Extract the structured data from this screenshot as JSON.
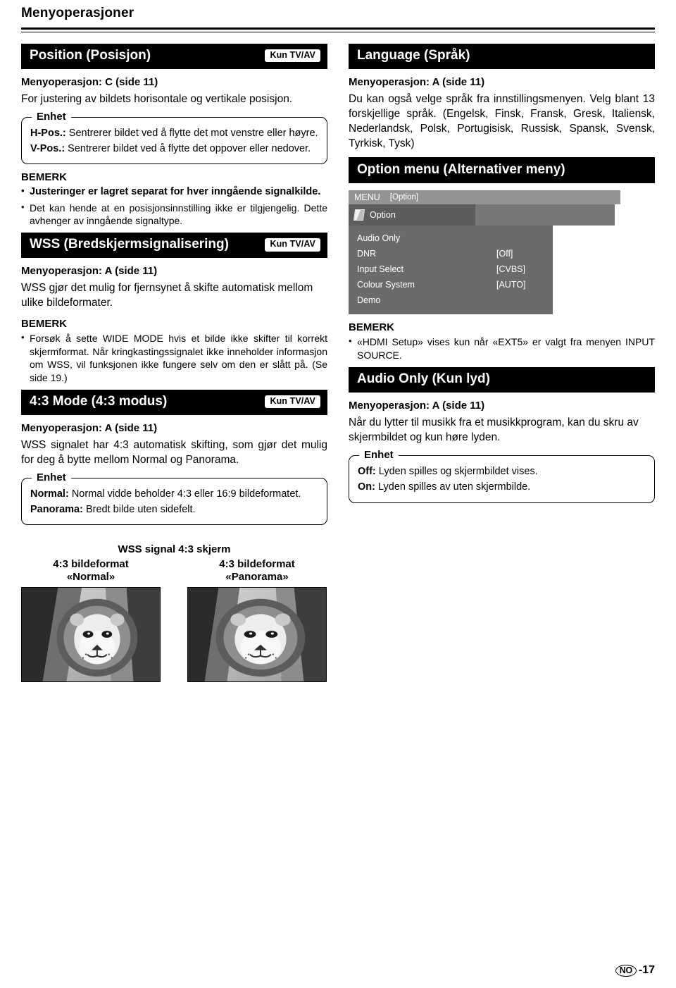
{
  "header": {
    "title": "Menyoperasjoner"
  },
  "left": {
    "position": {
      "title": "Position (Posisjon)",
      "badge": "Kun TV/AV",
      "menuop": "Menyoperasjon: C (side 11)",
      "intro": "For justering av bildets horisontale og vertikale posisjon.",
      "enhet_legend": "Enhet",
      "hpos_label": "H-Pos.:",
      "hpos_text": " Sentrerer bildet ved å flytte det mot venstre eller høyre.",
      "vpos_label": "V-Pos.:",
      "vpos_text": " Sentrerer bildet ved å flytte det oppover eller nedover.",
      "bemerk": "BEMERK",
      "notes": [
        "Justeringer er lagret separat for hver inngående signalkilde.",
        "Det kan hende at en posisjonsinnstilling ikke er tilgjengelig. Dette avhenger av inngående signaltype."
      ]
    },
    "wss": {
      "title": "WSS (Bredskjermsignalisering)",
      "badge": "Kun TV/AV",
      "menuop": "Menyoperasjon: A (side 11)",
      "intro": "WSS gjør det mulig for fjernsynet å skifte automatisk mellom ulike bildeformater.",
      "bemerk": "BEMERK",
      "notes": [
        "Forsøk å sette WIDE MODE hvis et bilde ikke skifter til korrekt skjermformat. Når kringkastingssignalet ikke inneholder informasjon om WSS, vil funksjonen ikke fungere selv om den er slått på. (Se side 19.)"
      ]
    },
    "mode43": {
      "title": "4:3 Mode (4:3 modus)",
      "badge": "Kun TV/AV",
      "menuop": "Menyoperasjon: A (side 11)",
      "intro": "WSS signalet har 4:3 automatisk skifting, som gjør det mulig for deg å bytte mellom Normal og Panorama.",
      "enhet_legend": "Enhet",
      "normal_label": "Normal:",
      "normal_text": " Normal vidde beholder 4:3 eller 16:9 bildeformatet.",
      "panorama_label": "Panorama:",
      "panorama_text": " Bredt bilde uten sidefelt."
    },
    "samples": {
      "caption": "WSS signal 4:3 skjerm",
      "items": [
        {
          "line1": "4:3 bildeformat",
          "line2": "«Normal»"
        },
        {
          "line1": "4:3 bildeformat",
          "line2": "«Panorama»"
        }
      ]
    }
  },
  "right": {
    "language": {
      "title": "Language (Språk)",
      "menuop": "Menyoperasjon: A (side 11)",
      "body": "Du kan også velge språk fra innstillingsmenyen. Velg blant 13 forskjellige språk. (Engelsk, Finsk, Fransk, Gresk, Italiensk, Nederlandsk, Polsk, Portugisisk, Russisk, Spansk, Svensk, Tyrkisk, Tysk)"
    },
    "option_menu": {
      "title": "Option menu (Alternativer meny)",
      "osd": {
        "menu_label": "MENU",
        "option_bracket": "[Option]",
        "tab_label": "Option",
        "items": [
          {
            "label": "Audio Only",
            "value": ""
          },
          {
            "label": "DNR",
            "value": "[Off]"
          },
          {
            "label": "Input Select",
            "value": "[CVBS]"
          },
          {
            "label": "Colour System",
            "value": "[AUTO]"
          },
          {
            "label": "Demo",
            "value": ""
          }
        ]
      },
      "bemerk": "BEMERK",
      "notes": [
        "«HDMI Setup» vises kun når «EXT5» er valgt fra menyen INPUT SOURCE."
      ]
    },
    "audio_only": {
      "title": "Audio Only (Kun lyd)",
      "menuop": "Menyoperasjon: A (side 11)",
      "body": "Når du lytter til musikk fra et musikkprogram, kan du skru av skjermbildet og kun høre lyden.",
      "enhet_legend": "Enhet",
      "off_label": "Off:",
      "off_text": " Lyden spilles og skjermbildet vises.",
      "on_label": "On:",
      "on_text": " Lyden spilles av uten skjermbilde."
    }
  },
  "footer": {
    "country": "NO",
    "page": "-17"
  }
}
